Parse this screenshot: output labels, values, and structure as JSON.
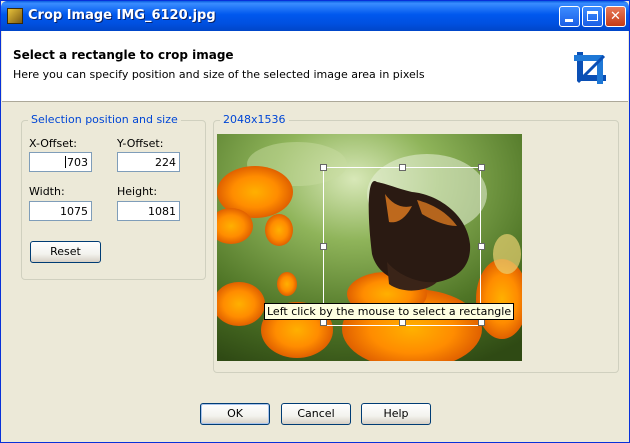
{
  "window": {
    "title": "Crop Image IMG_6120.jpg",
    "icon": "app-image-icon",
    "controls": {
      "minimize": "minimize-icon",
      "maximize": "maximize-icon",
      "close": "close-icon"
    }
  },
  "header": {
    "title": "Select a rectangle to crop image",
    "subtitle": "Here you can specify position and size of the selected image area in pixels",
    "icon": "crop-icon"
  },
  "selection": {
    "legend": "Selection position and size",
    "x_offset_label": "X-Offset:",
    "x_offset_value": "703",
    "y_offset_label": "Y-Offset:",
    "y_offset_value": "224",
    "width_label": "Width:",
    "width_value": "1075",
    "height_label": "Height:",
    "height_value": "1081",
    "reset_label": "Reset"
  },
  "image": {
    "legend": "2048x1536",
    "tooltip": "Left click by the mouse to select a rectangle"
  },
  "buttons": {
    "ok": "OK",
    "cancel": "Cancel",
    "help": "Help"
  },
  "colors": {
    "titlebar": "#0058ee",
    "legend_text": "#0046d5",
    "dialog_bg": "#ece9d8"
  }
}
